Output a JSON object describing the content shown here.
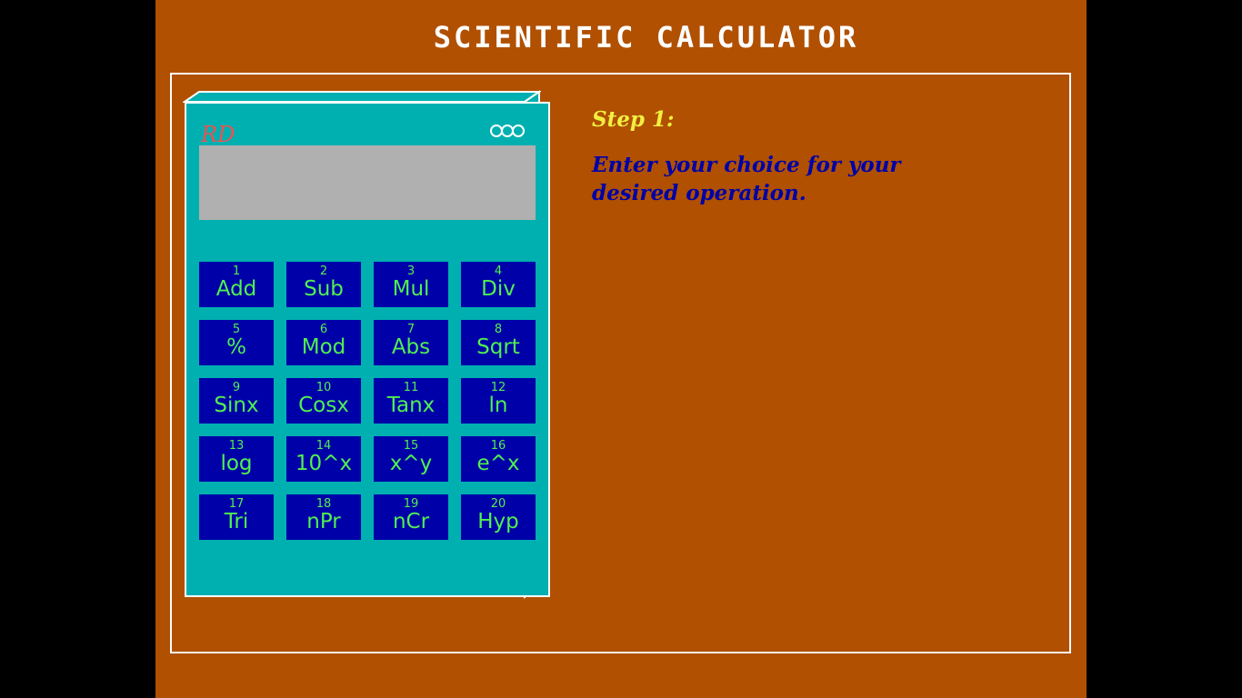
{
  "app": {
    "title": "SCIENTIFIC CALCULATOR"
  },
  "calculator": {
    "brand": "RD",
    "display_value": "",
    "keys": [
      {
        "num": "1",
        "label": "Add"
      },
      {
        "num": "2",
        "label": "Sub"
      },
      {
        "num": "3",
        "label": "Mul"
      },
      {
        "num": "4",
        "label": "Div"
      },
      {
        "num": "5",
        "label": "%"
      },
      {
        "num": "6",
        "label": "Mod"
      },
      {
        "num": "7",
        "label": "Abs"
      },
      {
        "num": "8",
        "label": "Sqrt"
      },
      {
        "num": "9",
        "label": "Sinx"
      },
      {
        "num": "10",
        "label": "Cosx"
      },
      {
        "num": "11",
        "label": "Tanx"
      },
      {
        "num": "12",
        "label": "ln"
      },
      {
        "num": "13",
        "label": "log"
      },
      {
        "num": "14",
        "label": "10^x"
      },
      {
        "num": "15",
        "label": "x^y"
      },
      {
        "num": "16",
        "label": "e^x"
      },
      {
        "num": "17",
        "label": "Tri"
      },
      {
        "num": "18",
        "label": "nPr"
      },
      {
        "num": "19",
        "label": "nCr"
      },
      {
        "num": "20",
        "label": "Hyp"
      }
    ]
  },
  "instructions": {
    "step": "Step 1:",
    "text": "Enter your choice for your desired operation."
  },
  "colors": {
    "background": "#B05000",
    "calculator_body": "#00B0B0",
    "display": "#B0B0B0",
    "key_bg": "#0000A8",
    "key_text": "#50F050",
    "step_text": "#F0F040",
    "instruction_text": "#0000A8",
    "brand_text": "#F05050"
  }
}
